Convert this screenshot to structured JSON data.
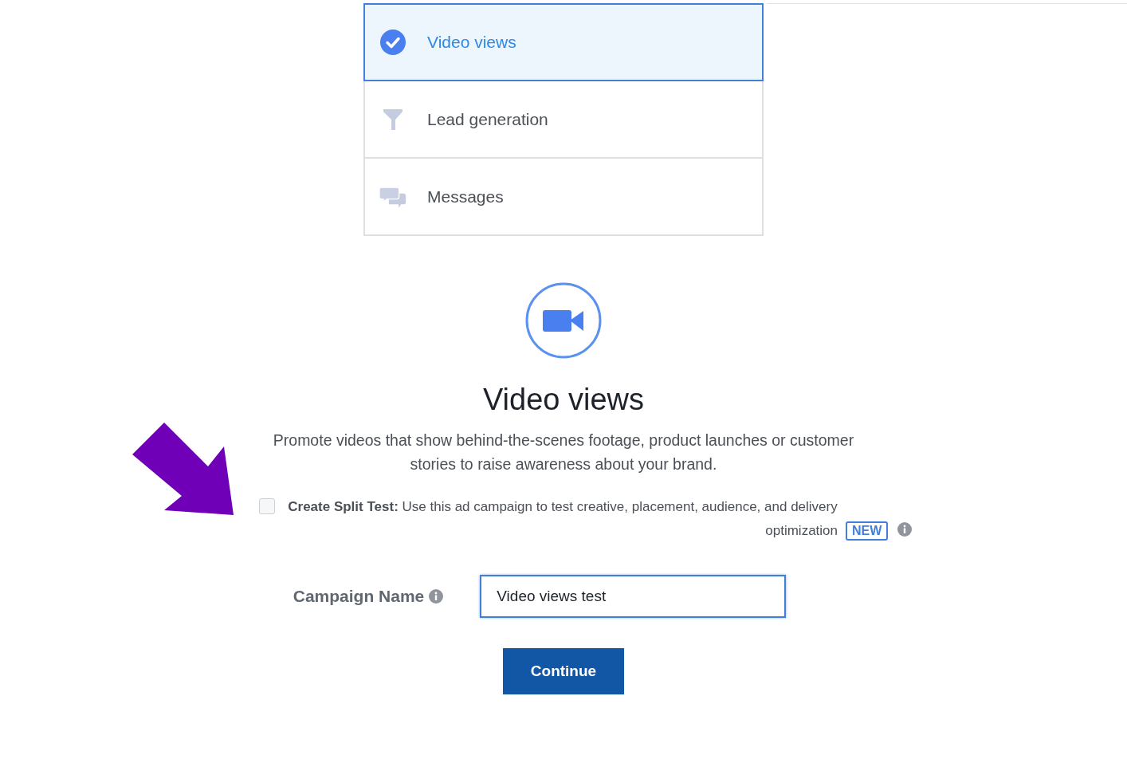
{
  "objectives": [
    {
      "label": "Video views",
      "kind": "check",
      "selected": true
    },
    {
      "label": "Lead generation",
      "kind": "funnel",
      "selected": false
    },
    {
      "label": "Messages",
      "kind": "messages",
      "selected": false
    }
  ],
  "detail": {
    "title": "Video views",
    "description": "Promote videos that show behind-the-scenes footage, product launches or customer stories to raise awareness about your brand."
  },
  "split_test": {
    "checked": false,
    "text": "**Create Split Test:** Use this ad campaign to test creative, placement, audience, and delivery optimization",
    "badge": "NEW"
  },
  "campaign_name": {
    "label": "Campaign Name",
    "value": "Video views test"
  },
  "continue_button": "Continue"
}
